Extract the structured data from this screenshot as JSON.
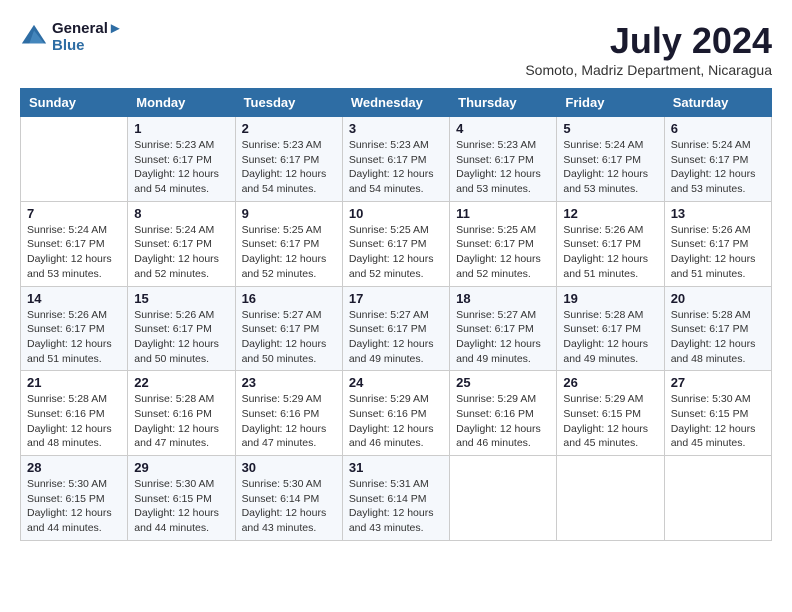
{
  "header": {
    "logo_line1": "General",
    "logo_line2": "Blue",
    "month_year": "July 2024",
    "location": "Somoto, Madriz Department, Nicaragua"
  },
  "days_of_week": [
    "Sunday",
    "Monday",
    "Tuesday",
    "Wednesday",
    "Thursday",
    "Friday",
    "Saturday"
  ],
  "weeks": [
    [
      {
        "day": "",
        "sunrise": "",
        "sunset": "",
        "daylight": ""
      },
      {
        "day": "1",
        "sunrise": "Sunrise: 5:23 AM",
        "sunset": "Sunset: 6:17 PM",
        "daylight": "Daylight: 12 hours and 54 minutes."
      },
      {
        "day": "2",
        "sunrise": "Sunrise: 5:23 AM",
        "sunset": "Sunset: 6:17 PM",
        "daylight": "Daylight: 12 hours and 54 minutes."
      },
      {
        "day": "3",
        "sunrise": "Sunrise: 5:23 AM",
        "sunset": "Sunset: 6:17 PM",
        "daylight": "Daylight: 12 hours and 54 minutes."
      },
      {
        "day": "4",
        "sunrise": "Sunrise: 5:23 AM",
        "sunset": "Sunset: 6:17 PM",
        "daylight": "Daylight: 12 hours and 53 minutes."
      },
      {
        "day": "5",
        "sunrise": "Sunrise: 5:24 AM",
        "sunset": "Sunset: 6:17 PM",
        "daylight": "Daylight: 12 hours and 53 minutes."
      },
      {
        "day": "6",
        "sunrise": "Sunrise: 5:24 AM",
        "sunset": "Sunset: 6:17 PM",
        "daylight": "Daylight: 12 hours and 53 minutes."
      }
    ],
    [
      {
        "day": "7",
        "sunrise": "Sunrise: 5:24 AM",
        "sunset": "Sunset: 6:17 PM",
        "daylight": "Daylight: 12 hours and 53 minutes."
      },
      {
        "day": "8",
        "sunrise": "Sunrise: 5:24 AM",
        "sunset": "Sunset: 6:17 PM",
        "daylight": "Daylight: 12 hours and 52 minutes."
      },
      {
        "day": "9",
        "sunrise": "Sunrise: 5:25 AM",
        "sunset": "Sunset: 6:17 PM",
        "daylight": "Daylight: 12 hours and 52 minutes."
      },
      {
        "day": "10",
        "sunrise": "Sunrise: 5:25 AM",
        "sunset": "Sunset: 6:17 PM",
        "daylight": "Daylight: 12 hours and 52 minutes."
      },
      {
        "day": "11",
        "sunrise": "Sunrise: 5:25 AM",
        "sunset": "Sunset: 6:17 PM",
        "daylight": "Daylight: 12 hours and 52 minutes."
      },
      {
        "day": "12",
        "sunrise": "Sunrise: 5:26 AM",
        "sunset": "Sunset: 6:17 PM",
        "daylight": "Daylight: 12 hours and 51 minutes."
      },
      {
        "day": "13",
        "sunrise": "Sunrise: 5:26 AM",
        "sunset": "Sunset: 6:17 PM",
        "daylight": "Daylight: 12 hours and 51 minutes."
      }
    ],
    [
      {
        "day": "14",
        "sunrise": "Sunrise: 5:26 AM",
        "sunset": "Sunset: 6:17 PM",
        "daylight": "Daylight: 12 hours and 51 minutes."
      },
      {
        "day": "15",
        "sunrise": "Sunrise: 5:26 AM",
        "sunset": "Sunset: 6:17 PM",
        "daylight": "Daylight: 12 hours and 50 minutes."
      },
      {
        "day": "16",
        "sunrise": "Sunrise: 5:27 AM",
        "sunset": "Sunset: 6:17 PM",
        "daylight": "Daylight: 12 hours and 50 minutes."
      },
      {
        "day": "17",
        "sunrise": "Sunrise: 5:27 AM",
        "sunset": "Sunset: 6:17 PM",
        "daylight": "Daylight: 12 hours and 49 minutes."
      },
      {
        "day": "18",
        "sunrise": "Sunrise: 5:27 AM",
        "sunset": "Sunset: 6:17 PM",
        "daylight": "Daylight: 12 hours and 49 minutes."
      },
      {
        "day": "19",
        "sunrise": "Sunrise: 5:28 AM",
        "sunset": "Sunset: 6:17 PM",
        "daylight": "Daylight: 12 hours and 49 minutes."
      },
      {
        "day": "20",
        "sunrise": "Sunrise: 5:28 AM",
        "sunset": "Sunset: 6:17 PM",
        "daylight": "Daylight: 12 hours and 48 minutes."
      }
    ],
    [
      {
        "day": "21",
        "sunrise": "Sunrise: 5:28 AM",
        "sunset": "Sunset: 6:16 PM",
        "daylight": "Daylight: 12 hours and 48 minutes."
      },
      {
        "day": "22",
        "sunrise": "Sunrise: 5:28 AM",
        "sunset": "Sunset: 6:16 PM",
        "daylight": "Daylight: 12 hours and 47 minutes."
      },
      {
        "day": "23",
        "sunrise": "Sunrise: 5:29 AM",
        "sunset": "Sunset: 6:16 PM",
        "daylight": "Daylight: 12 hours and 47 minutes."
      },
      {
        "day": "24",
        "sunrise": "Sunrise: 5:29 AM",
        "sunset": "Sunset: 6:16 PM",
        "daylight": "Daylight: 12 hours and 46 minutes."
      },
      {
        "day": "25",
        "sunrise": "Sunrise: 5:29 AM",
        "sunset": "Sunset: 6:16 PM",
        "daylight": "Daylight: 12 hours and 46 minutes."
      },
      {
        "day": "26",
        "sunrise": "Sunrise: 5:29 AM",
        "sunset": "Sunset: 6:15 PM",
        "daylight": "Daylight: 12 hours and 45 minutes."
      },
      {
        "day": "27",
        "sunrise": "Sunrise: 5:30 AM",
        "sunset": "Sunset: 6:15 PM",
        "daylight": "Daylight: 12 hours and 45 minutes."
      }
    ],
    [
      {
        "day": "28",
        "sunrise": "Sunrise: 5:30 AM",
        "sunset": "Sunset: 6:15 PM",
        "daylight": "Daylight: 12 hours and 44 minutes."
      },
      {
        "day": "29",
        "sunrise": "Sunrise: 5:30 AM",
        "sunset": "Sunset: 6:15 PM",
        "daylight": "Daylight: 12 hours and 44 minutes."
      },
      {
        "day": "30",
        "sunrise": "Sunrise: 5:30 AM",
        "sunset": "Sunset: 6:14 PM",
        "daylight": "Daylight: 12 hours and 43 minutes."
      },
      {
        "day": "31",
        "sunrise": "Sunrise: 5:31 AM",
        "sunset": "Sunset: 6:14 PM",
        "daylight": "Daylight: 12 hours and 43 minutes."
      },
      {
        "day": "",
        "sunrise": "",
        "sunset": "",
        "daylight": ""
      },
      {
        "day": "",
        "sunrise": "",
        "sunset": "",
        "daylight": ""
      },
      {
        "day": "",
        "sunrise": "",
        "sunset": "",
        "daylight": ""
      }
    ]
  ]
}
